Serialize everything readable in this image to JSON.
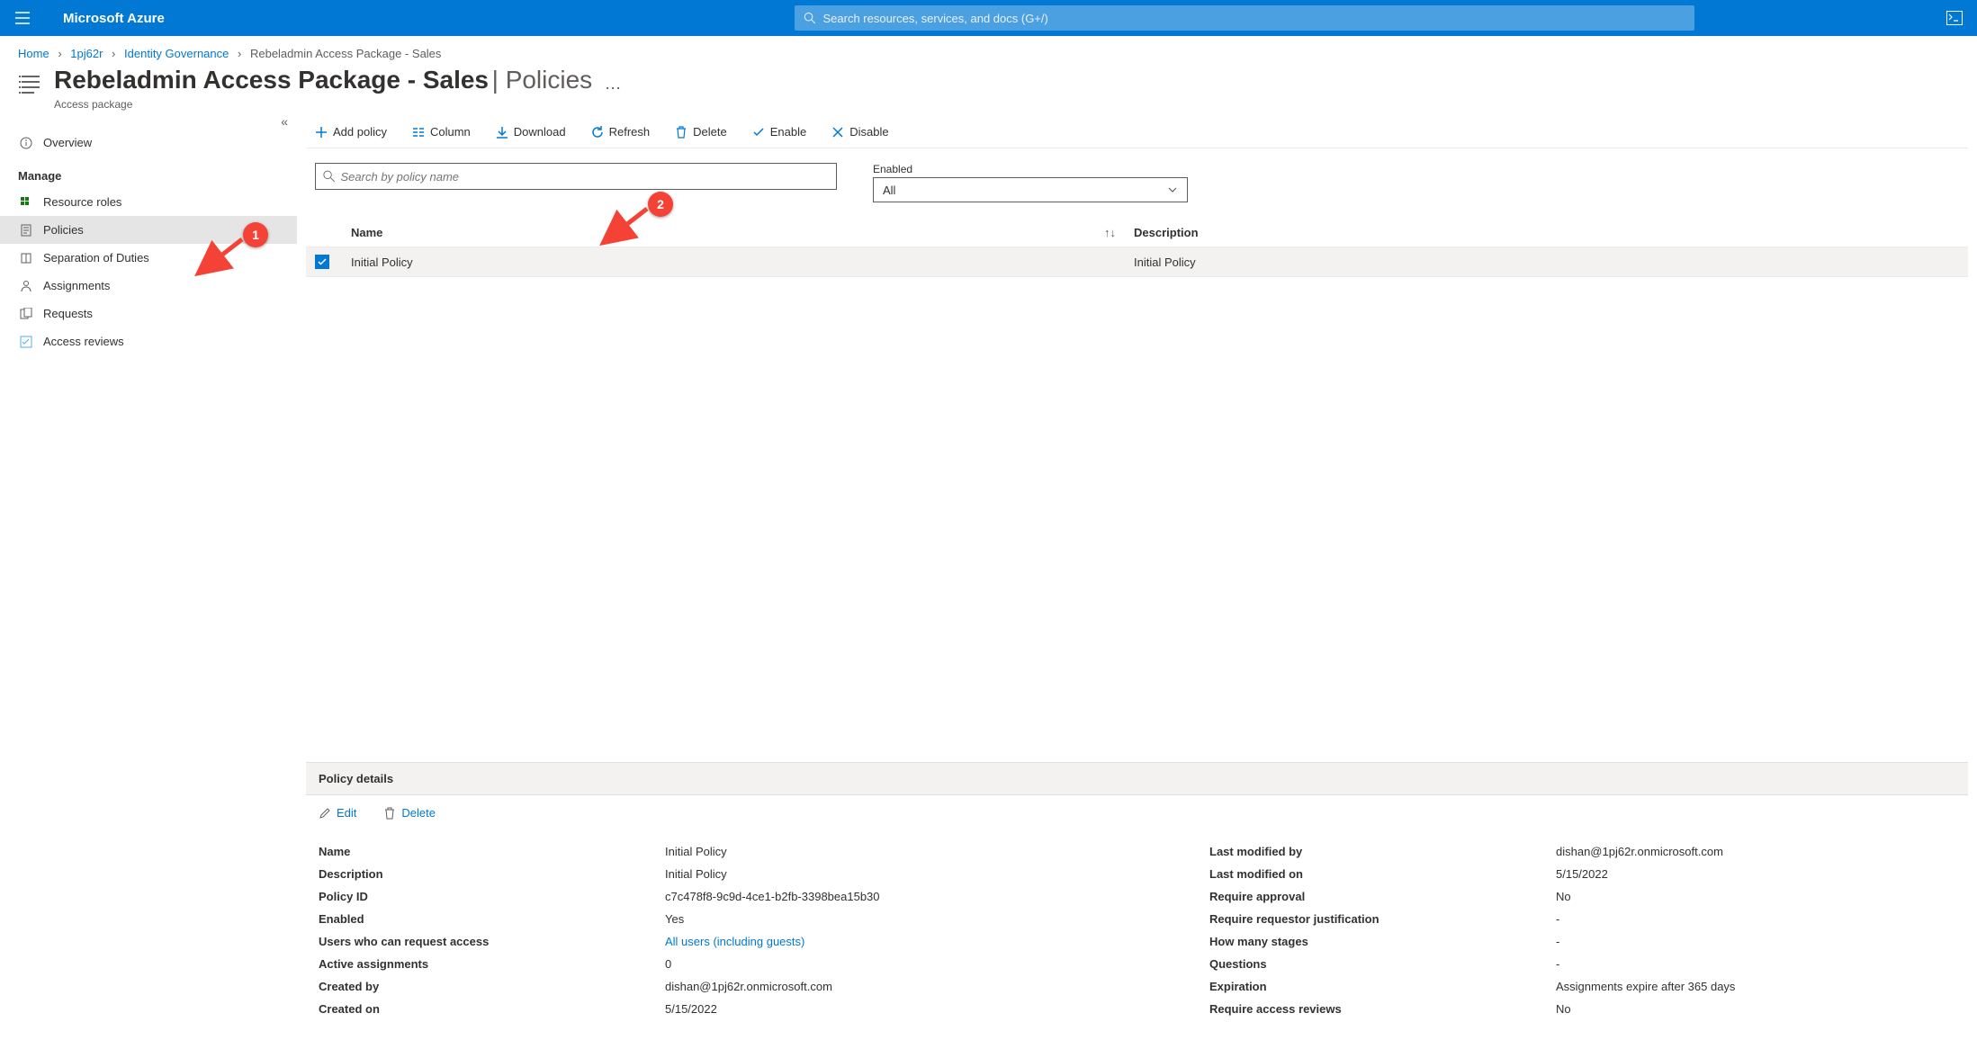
{
  "header": {
    "brand": "Microsoft Azure",
    "search_placeholder": "Search resources, services, and docs (G+/)"
  },
  "breadcrumb": {
    "items": [
      "Home",
      "1pj62r",
      "Identity Governance",
      "Rebeladmin Access Package - Sales"
    ]
  },
  "title": {
    "main": "Rebeladmin Access Package - Sales",
    "sub": "Policies",
    "resource_type": "Access package"
  },
  "sidebar": {
    "overview": "Overview",
    "manage_header": "Manage",
    "items": [
      {
        "label": "Resource roles"
      },
      {
        "label": "Policies"
      },
      {
        "label": "Separation of Duties"
      },
      {
        "label": "Assignments"
      },
      {
        "label": "Requests"
      },
      {
        "label": "Access reviews"
      }
    ]
  },
  "toolbar": {
    "add": "Add policy",
    "column": "Column",
    "download": "Download",
    "refresh": "Refresh",
    "delete": "Delete",
    "enable": "Enable",
    "disable": "Disable"
  },
  "filters": {
    "search_placeholder": "Search by policy name",
    "enabled_label": "Enabled",
    "enabled_value": "All"
  },
  "table": {
    "col_name": "Name",
    "col_desc": "Description",
    "rows": [
      {
        "name": "Initial Policy",
        "description": "Initial Policy",
        "checked": true
      }
    ]
  },
  "details": {
    "title": "Policy details",
    "edit": "Edit",
    "delete": "Delete",
    "left_labels": [
      "Name",
      "Description",
      "Policy ID",
      "Enabled",
      "Users who can request access",
      "Active assignments",
      "Created by",
      "Created on"
    ],
    "left_values": {
      "name": "Initial Policy",
      "description": "Initial Policy",
      "policy_id": "c7c478f8-9c9d-4ce1-b2fb-3398bea15b30",
      "enabled": "Yes",
      "users_link": "All users (including guests)",
      "active_assignments": "0",
      "created_by": "dishan@1pj62r.onmicrosoft.com",
      "created_on": "5/15/2022"
    },
    "right_labels": [
      "Last modified by",
      "Last modified on",
      "Require approval",
      "Require requestor justification",
      "How many stages",
      "Questions",
      "Expiration",
      "Require access reviews"
    ],
    "right_values": {
      "last_modified_by": "dishan@1pj62r.onmicrosoft.com",
      "last_modified_on": "5/15/2022",
      "require_approval": "No",
      "require_justification": "-",
      "stages": "-",
      "questions": "-",
      "expiration": "Assignments expire after 365 days",
      "require_reviews": "No"
    }
  },
  "callouts": {
    "c1": "1",
    "c2": "2"
  }
}
